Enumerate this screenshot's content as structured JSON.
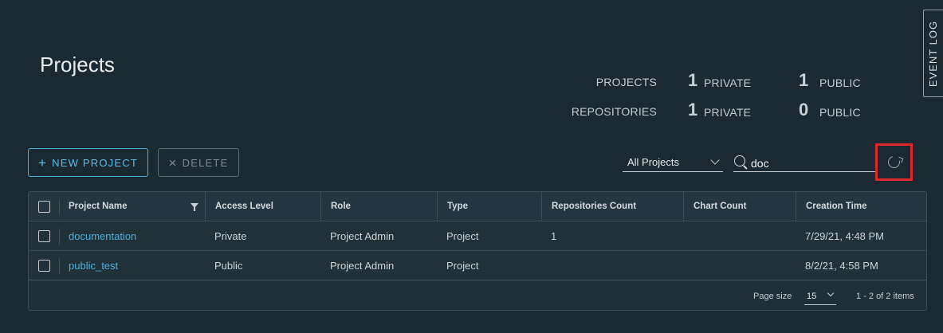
{
  "header": {
    "title": "Projects"
  },
  "stats": {
    "projects_label": "PROJECTS",
    "projects_private": "1",
    "projects_private_label": "PRIVATE",
    "projects_public": "1",
    "projects_public_label": "PUBLIC",
    "repos_label": "REPOSITORIES",
    "repos_private": "1",
    "repos_private_label": "PRIVATE",
    "repos_public": "0",
    "repos_public_label": "PUBLIC"
  },
  "side_tab": {
    "label": "EVENT LOG"
  },
  "toolbar": {
    "new_label": "NEW PROJECT",
    "new_icon": "plus-icon",
    "delete_label": "DELETE",
    "delete_icon": "close-icon",
    "filter_value": "All Projects",
    "search_value": "doc",
    "refresh_icon": "refresh-icon",
    "highlight_color": "#e0262b"
  },
  "table": {
    "columns": [
      "Project Name",
      "Access Level",
      "Role",
      "Type",
      "Repositories Count",
      "Chart Count",
      "Creation Time"
    ],
    "rows": [
      {
        "name": "documentation",
        "access": "Private",
        "role": "Project Admin",
        "type": "Project",
        "repos": "1",
        "charts": "",
        "created": "7/29/21, 4:48 PM"
      },
      {
        "name": "public_test",
        "access": "Public",
        "role": "Project Admin",
        "type": "Project",
        "repos": "",
        "charts": "",
        "created": "8/2/21, 4:58 PM"
      }
    ]
  },
  "footer": {
    "page_size_label": "Page size",
    "page_size_value": "15",
    "count_text": "1 - 2 of 2 items"
  },
  "colors": {
    "background": "#1b2a32",
    "link": "#4eaedc",
    "primary": "#4aaed9"
  }
}
